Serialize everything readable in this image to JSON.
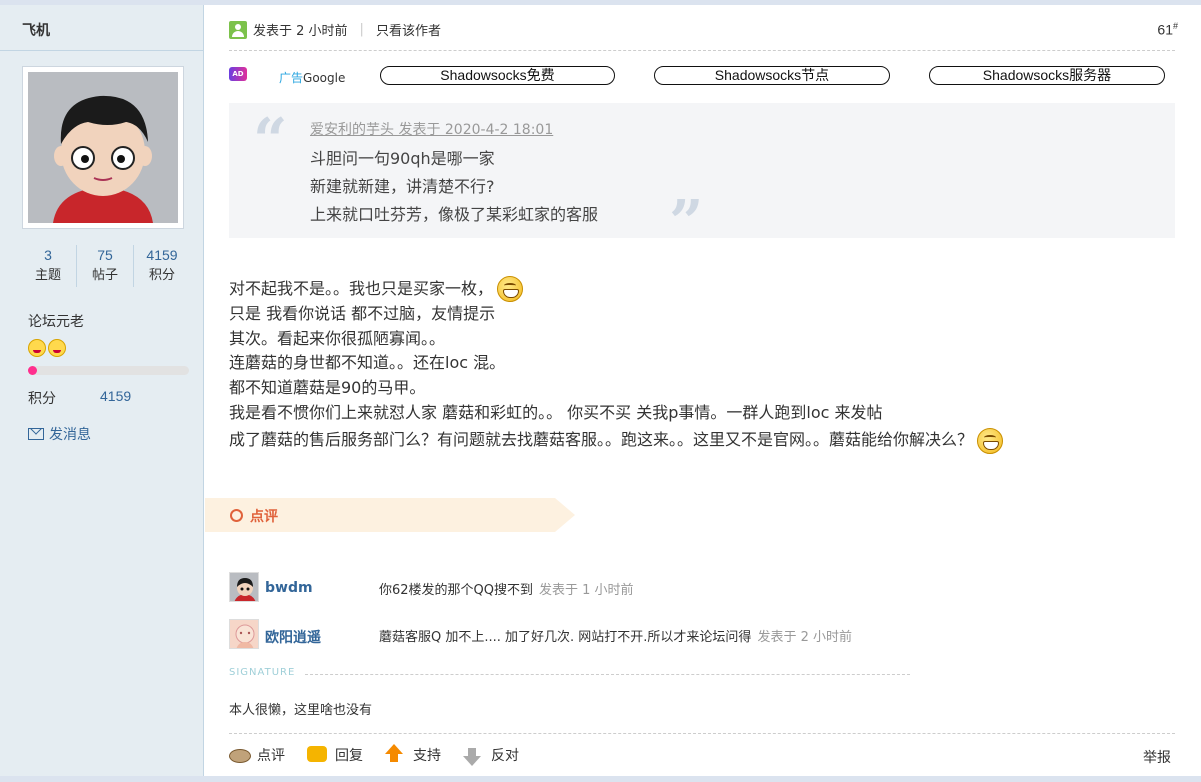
{
  "author": {
    "name": "飞机",
    "stats": [
      {
        "value": "3",
        "label": "主题"
      },
      {
        "value": "75",
        "label": "帖子"
      },
      {
        "value": "4159",
        "label": "积分"
      }
    ],
    "rank": "论坛元老",
    "progress_fraction": 0.05,
    "score_label": "积分",
    "score_value": "4159",
    "send_message": "发消息"
  },
  "post": {
    "posted_at": "发表于 2 小时前",
    "separator": "|",
    "only_author": "只看该作者",
    "floor": "61",
    "floor_sup": "#",
    "ad": {
      "badge": "AD",
      "label_prefix": "广告",
      "label_brand": "Google",
      "links": [
        "Shadowsocks免费",
        "Shadowsocks节点",
        "Shadowsocks服务器"
      ]
    },
    "quote": {
      "meta": "爱安利的芋头 发表于 2020-4-2 18:01",
      "lines": [
        "斗胆问一句90qh是哪一家",
        "新建就新建，讲清楚不行?",
        "上来就口吐芬芳，像极了某彩虹家的客服"
      ]
    },
    "content_lines": [
      "对不起我不是。。我也只是买家一枚，",
      "只是 我看你说话 都不过脑，友情提示",
      "其次。看起来你很孤陋寡闻。。",
      "连蘑菇的身世都不知道。。还在loc 混。",
      "都不知道蘑菇是90的马甲。",
      "我是看不惯你们上来就怼人家 蘑菇和彩虹的。。 你买不买 关我p事情。一群人跑到loc 来发帖",
      "成了蘑菇的售后服务部门么？有问题就去找蘑菇客服。。跑这来。。这里又不是官网。。蘑菇能给你解决么？"
    ],
    "comment_section": "点评",
    "comments": [
      {
        "user": "bwdm",
        "text": "你62楼发的那个QQ搜不到",
        "time": "发表于 1 小时前"
      },
      {
        "user": "欧阳逍遥",
        "text": "蘑菇客服Q 加不上.... 加了好几次. 网站打不开.所以才来论坛问得",
        "time": "发表于 2 小时前"
      }
    ],
    "signature_label": "SIGNATURE",
    "signature": "本人很懒，这里啥也没有",
    "actions": [
      "点评",
      "回复",
      "支持",
      "反对"
    ],
    "report": "举报"
  }
}
